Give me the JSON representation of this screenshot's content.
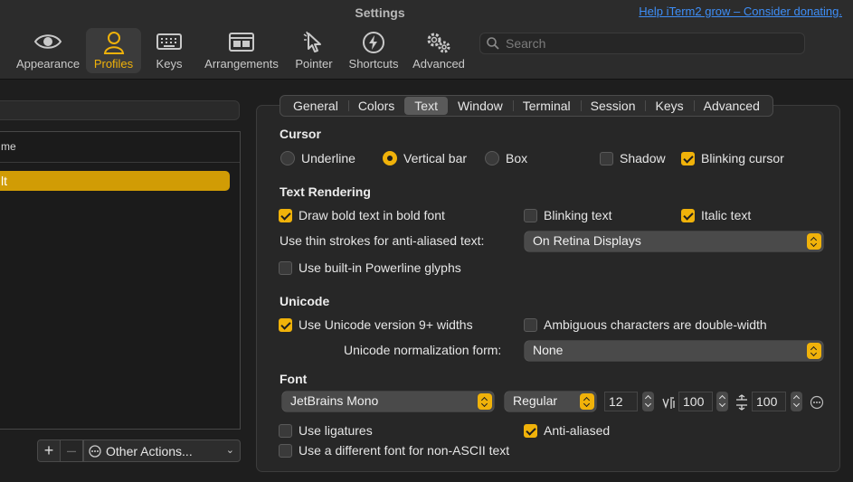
{
  "window": {
    "title": "Settings",
    "donate_link": "Help iTerm2 grow – Consider donating."
  },
  "toolbar": {
    "items": [
      {
        "label": "Appearance",
        "icon": "eye-icon"
      },
      {
        "label": "Profiles",
        "icon": "person-icon",
        "active": true
      },
      {
        "label": "Keys",
        "icon": "keyboard-icon"
      },
      {
        "label": "Arrangements",
        "icon": "windows-icon"
      },
      {
        "label": "Pointer",
        "icon": "pointer-icon"
      },
      {
        "label": "Shortcuts",
        "icon": "bolt-icon"
      },
      {
        "label": "Advanced",
        "icon": "gears-icon"
      }
    ],
    "search_placeholder": "Search"
  },
  "profiles": {
    "column_header": "me",
    "selected_profile": "lt",
    "other_actions_label": "Other Actions...",
    "add_label": "+",
    "remove_label": "–"
  },
  "tabs": [
    {
      "label": "General"
    },
    {
      "label": "Colors"
    },
    {
      "label": "Text",
      "active": true
    },
    {
      "label": "Window"
    },
    {
      "label": "Terminal"
    },
    {
      "label": "Session"
    },
    {
      "label": "Keys"
    },
    {
      "label": "Advanced"
    }
  ],
  "cursor": {
    "title": "Cursor",
    "underline": "Underline",
    "vertical_bar": "Vertical bar",
    "box": "Box",
    "selected": "Vertical bar",
    "shadow": "Shadow",
    "shadow_checked": false,
    "blinking": "Blinking cursor",
    "blinking_checked": true
  },
  "text_rendering": {
    "title": "Text Rendering",
    "bold": "Draw bold text in bold font",
    "bold_checked": true,
    "blinking_text": "Blinking text",
    "blinking_text_checked": false,
    "italic": "Italic text",
    "italic_checked": true,
    "thin_strokes_label": "Use thin strokes for anti-aliased text:",
    "thin_strokes_value": "On Retina Displays",
    "powerline": "Use built-in Powerline glyphs",
    "powerline_checked": false
  },
  "unicode": {
    "title": "Unicode",
    "version9": "Use Unicode version 9+ widths",
    "version9_checked": true,
    "ambiguous": "Ambiguous characters are double-width",
    "ambiguous_checked": false,
    "normalization_label": "Unicode normalization form:",
    "normalization_value": "None"
  },
  "font": {
    "title": "Font",
    "family": "JetBrains Mono",
    "style": "Regular",
    "size": "12",
    "h_spacing": "100",
    "v_spacing": "100",
    "ligatures": "Use ligatures",
    "ligatures_checked": false,
    "anti_aliased": "Anti-aliased",
    "anti_aliased_checked": true,
    "non_ascii": "Use a different font for non-ASCII text",
    "non_ascii_checked": false
  },
  "colors": {
    "accent": "#f0b20a",
    "selection": "#d19c05",
    "link": "#3e8ef7"
  }
}
